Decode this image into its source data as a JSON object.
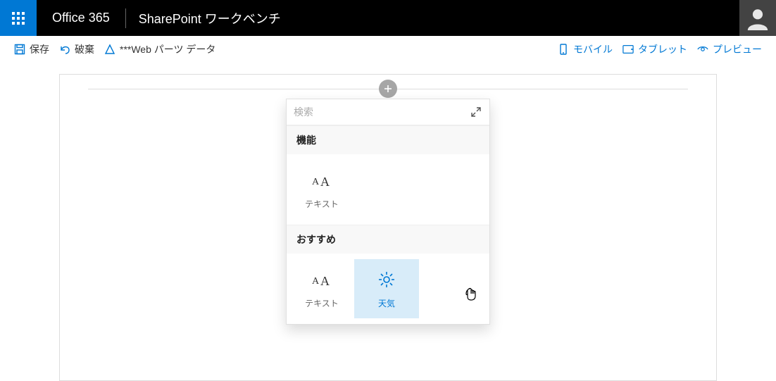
{
  "header": {
    "brand": "Office 365",
    "title": "SharePoint ワークベンチ"
  },
  "commands": {
    "save": "保存",
    "discard": "破棄",
    "webparts_data": "***Web パーツ データ",
    "mobile": "モバイル",
    "tablet": "タブレット",
    "preview": "プレビュー"
  },
  "picker": {
    "search_placeholder": "検索",
    "group1_title": "機能",
    "group1": [
      {
        "label": "テキスト",
        "kind": "text"
      }
    ],
    "group2_title": "おすすめ",
    "group2": [
      {
        "label": "テキスト",
        "kind": "text",
        "selected": false
      },
      {
        "label": "天気",
        "kind": "weather",
        "selected": true
      }
    ]
  }
}
